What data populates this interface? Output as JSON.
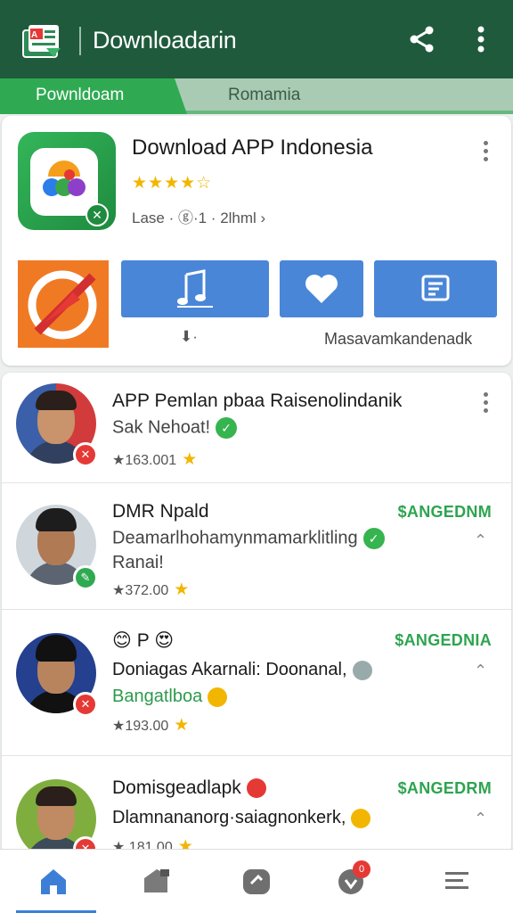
{
  "header": {
    "title": "Downloadarin",
    "logo_icon": "app-logo-icon",
    "share_icon": "share-icon",
    "more_icon": "more-vertical-icon"
  },
  "tabs": [
    {
      "label": "Pownldoam",
      "active": true
    },
    {
      "label": "Romamia",
      "active": false
    }
  ],
  "featured": {
    "title": "Download APP Indonesia",
    "rating_stars": "★★★★☆",
    "rating": 4.5,
    "meta": "Lase · ⓖ·1 · 2lhml ›",
    "download_count": "⬇·",
    "action_caption": "Masavamkandenadk",
    "actions": [
      "music-icon",
      "heart-icon",
      "playlist-icon"
    ]
  },
  "list": [
    {
      "title": "APP Pemlan pbaa Raisenolindanik",
      "subtitle": "Sak Nehoat!",
      "subtitle_green": false,
      "verified": true,
      "rating": "★163.001",
      "price": "",
      "badge": "red"
    },
    {
      "title": "DMR Npald",
      "subtitle": "Deamarlhohamynmamarklitling",
      "subtitle2": "Ranai!",
      "verified": true,
      "rating": "★372.00",
      "price": "$ANGEDNM",
      "badge": "green"
    },
    {
      "title": "😊 P 😍",
      "subtitle": "Doniagas Akarnali: Doonanal,",
      "subtitle2": "Bangatlboa",
      "rating": "★193.00",
      "price": "$ANGEDNIA",
      "badge": "red"
    },
    {
      "title": "Domisgeadlapk",
      "subtitle": "Dlamnananorg·saiagnonkerk,",
      "rating": "★ 181.00",
      "price": "$ANGEDRM",
      "badge": "red"
    }
  ],
  "bottom_nav": [
    {
      "icon": "home-icon",
      "active": true
    },
    {
      "icon": "apps-icon",
      "active": false
    },
    {
      "icon": "games-icon",
      "active": false
    },
    {
      "icon": "notifications-icon",
      "active": false,
      "badge": "0"
    },
    {
      "icon": "menu-icon",
      "active": false
    }
  ],
  "colors": {
    "appbar": "#1f5a3c",
    "tab_active": "#2faa52",
    "action_blue": "#4a86d8",
    "price_green": "#2ea44f",
    "star": "#f2b600"
  }
}
